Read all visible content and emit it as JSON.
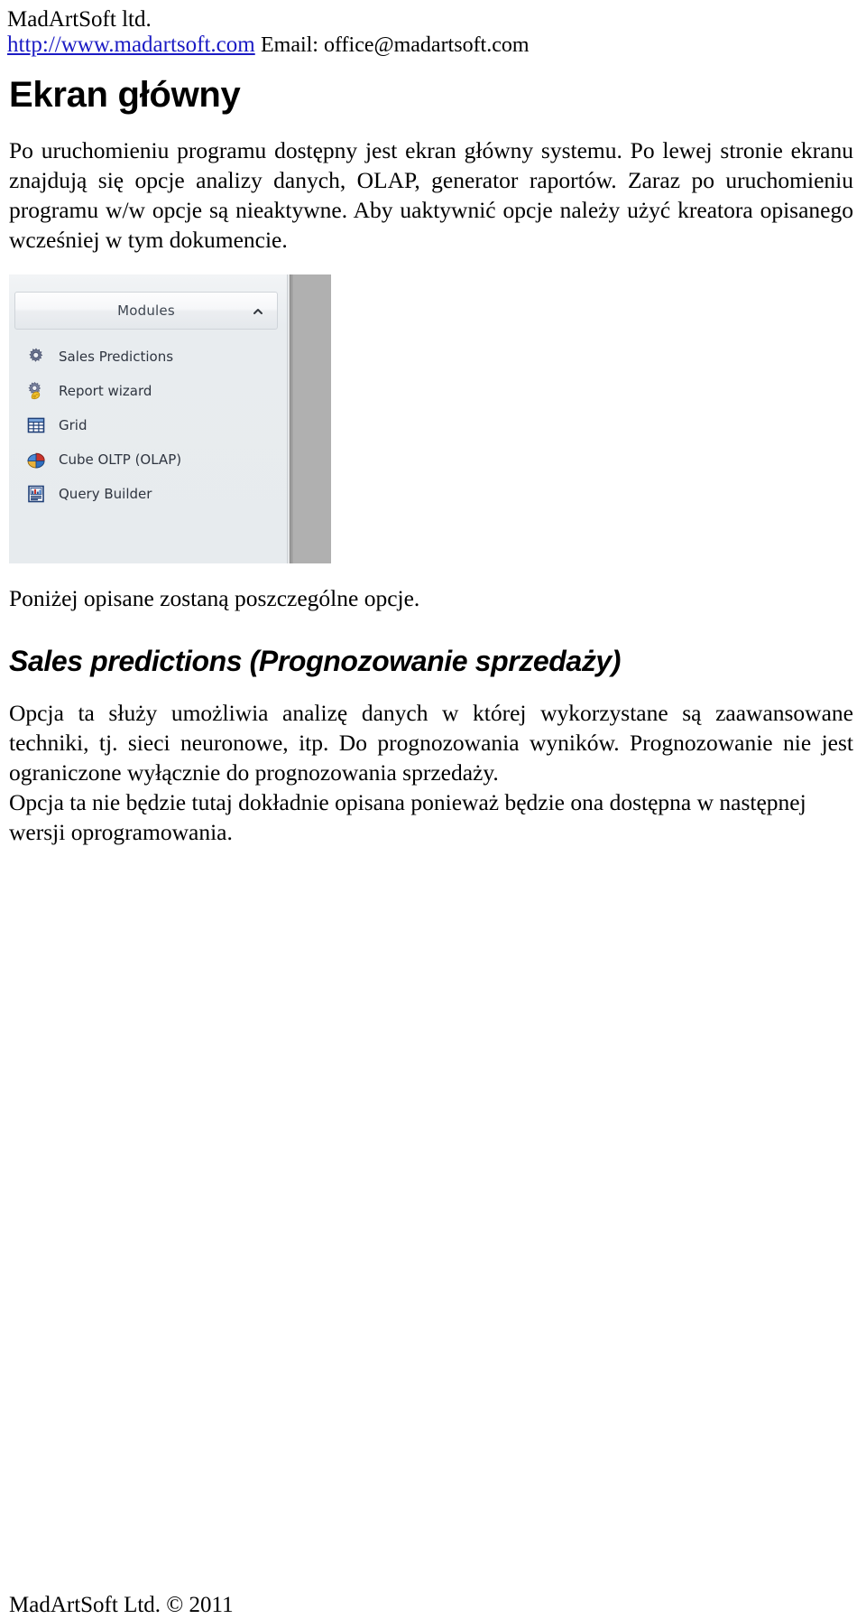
{
  "header": {
    "company": "MadArtSoft ltd.",
    "url": "http://www.madartsoft.com",
    "email": "Email: office@madartsoft.com",
    "link_color": "#1b1bc4"
  },
  "title": "Ekran główny",
  "intro_paragraph": "Po uruchomieniu programu dostępny jest ekran główny systemu. Po lewej stronie ekranu znajdują się opcje analizy danych, OLAP, generator raportów. Zaraz po uruchomieniu programu w/w opcje są nieaktywne. Aby uaktywnić opcje należy użyć kreatora opisanego wcześniej w tym dokumencie.",
  "screenshot": {
    "panel": {
      "title": "Modules",
      "collapse_icon": "chevron-up-icon"
    },
    "modules": [
      {
        "label": "Sales Predictions",
        "icon": "gear-icon"
      },
      {
        "label": "Report wizard",
        "icon": "gear-wand-icon"
      },
      {
        "label": "Grid",
        "icon": "table-grid-icon"
      },
      {
        "label": "Cube OLTP (OLAP)",
        "icon": "pie-chart-icon"
      },
      {
        "label": "Query Builder",
        "icon": "bar-chart-report-icon"
      }
    ]
  },
  "after_screenshot_paragraph": "Poniżej opisane zostaną poszczególne opcje.",
  "section_heading": "Sales predictions (Prognozowanie sprzedaży)",
  "section_paragraph_1": "Opcja ta służy umożliwia analizę danych w której wykorzystane są zaawansowane techniki, tj. sieci neuronowe, itp. Do prognozowania wyników. Prognozowanie nie jest ograniczone wyłącznie do prognozowania sprzedaży.",
  "section_paragraph_2": "Opcja ta nie będzie tutaj dokładnie opisana ponieważ będzie ona dostępna w następnej wersji oprogramowania.",
  "footer": "MadArtSoft Ltd. © 2011"
}
